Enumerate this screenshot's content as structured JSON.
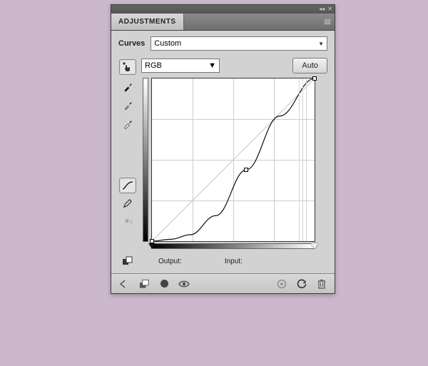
{
  "panel": {
    "tab_title": "ADJUSTMENTS",
    "preset_label": "Curves",
    "preset_value": "Custom",
    "channel_value": "RGB",
    "auto_label": "Auto",
    "output_label": "Output:",
    "input_label": "Input:"
  },
  "icons": {
    "collapse": "◂◂",
    "close": "✕",
    "menu": "▤",
    "finger": "↕",
    "eyedrop_black": "eyedropper-black",
    "eyedrop_gray": "eyedropper-gray",
    "eyedrop_white": "eyedropper-white",
    "mode_curve": "∿",
    "mode_pencil": "✎",
    "mode_smooth": "✦ₛ",
    "clip": "clip-icon",
    "back": "◁",
    "layers": "layers-icon",
    "mask": "●",
    "eye": "👁",
    "target": "◎",
    "reset": "↻",
    "trash": "🗑"
  },
  "chart_data": {
    "type": "line",
    "title": "",
    "xlabel": "Input",
    "ylabel": "Output",
    "xlim": [
      0,
      255
    ],
    "ylim": [
      0,
      255
    ],
    "grid": true,
    "series": [
      {
        "name": "baseline",
        "x": [
          0,
          255
        ],
        "y": [
          0,
          255
        ]
      },
      {
        "name": "curve",
        "x": [
          0,
          30,
          60,
          100,
          148,
          200,
          255
        ],
        "y": [
          0,
          3,
          10,
          40,
          112,
          196,
          255
        ]
      }
    ],
    "control_points": [
      {
        "x": 0,
        "y": 0
      },
      {
        "x": 148,
        "y": 112
      },
      {
        "x": 255,
        "y": 255
      }
    ],
    "grid_x_minor": [
      230,
      236,
      242
    ]
  }
}
